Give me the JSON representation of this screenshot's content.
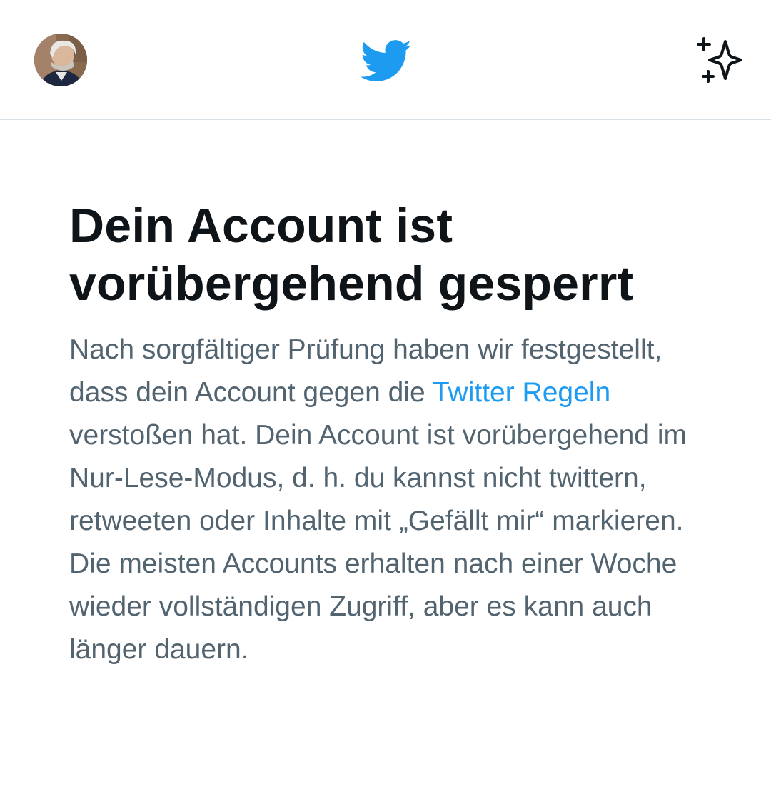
{
  "header": {
    "avatar_icon": "user-avatar",
    "logo_icon": "twitter-bird-icon",
    "sparkle_icon": "sparkle-icon",
    "brand_color": "#1d9bf0"
  },
  "notice": {
    "title_line1": "Dein Account ist",
    "title_line2": "vorübergehend gesperrt",
    "body_before_link": "Nach sorgfältiger Prüfung haben wir festgestellt, dass dein Account gegen die ",
    "link_text": "Twitter Regeln",
    "body_after_link": " verstoßen hat. Dein Account ist vorübergehend im Nur-Lese-Modus, d. h. du kannst nicht twittern, retweeten oder Inhalte mit „Gefällt mir“ markieren. Die meisten Accounts erhalten nach einer Woche wieder vollständigen Zugriff, aber es kann auch länger dauern.",
    "text_color": "#536471",
    "title_color": "#0f1419",
    "link_color": "#1d9bf0"
  }
}
